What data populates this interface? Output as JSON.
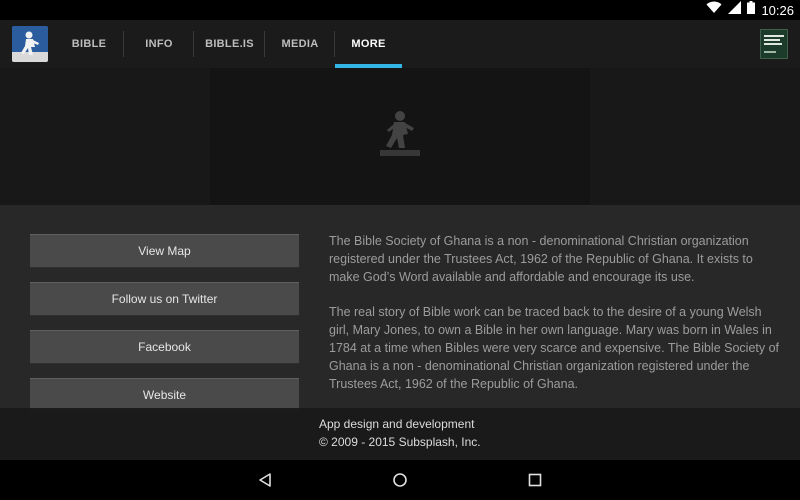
{
  "status_bar": {
    "time": "10:26",
    "icons": [
      "wifi-icon",
      "signal-icon",
      "battery-icon"
    ]
  },
  "app_bar": {
    "logo_icon": "app-logo-icon",
    "tabs": [
      {
        "label": "BIBLE",
        "active": false
      },
      {
        "label": "INFO",
        "active": false
      },
      {
        "label": "BIBLE.IS",
        "active": false
      },
      {
        "label": "MEDIA",
        "active": false
      },
      {
        "label": "MORE",
        "active": true
      }
    ],
    "accent_color": "#33b5e5",
    "thumbnail_icon": "book-cover-icon"
  },
  "banner": {
    "figure_icon": "runner-figure-icon"
  },
  "buttons": [
    {
      "label": "View Map"
    },
    {
      "label": "Follow us on Twitter"
    },
    {
      "label": "Facebook"
    },
    {
      "label": "Website"
    }
  ],
  "description": {
    "paragraph_1": "The Bible Society of Ghana is a non - denominational Christian organization registered under the Trustees Act, 1962 of the Republic of Ghana. It exists to make God’s Word available and affordable and encourage its use.",
    "paragraph_2": "The real story of Bible work can be traced back to the desire of a young Welsh girl, Mary Jones, to own a Bible in her own language. Mary was born in Wales in 1784 at a time when Bibles were very scarce and expensive. The Bible Society of Ghana is a non - denominational Christian organization registered under the Trustees Act, 1962 of the Republic of Ghana."
  },
  "footer": {
    "line_1": "App design and development",
    "line_2": "© 2009 - 2015 Subsplash, Inc."
  },
  "nav_bar": {
    "icons": [
      "back-icon",
      "home-icon",
      "recents-icon"
    ]
  }
}
